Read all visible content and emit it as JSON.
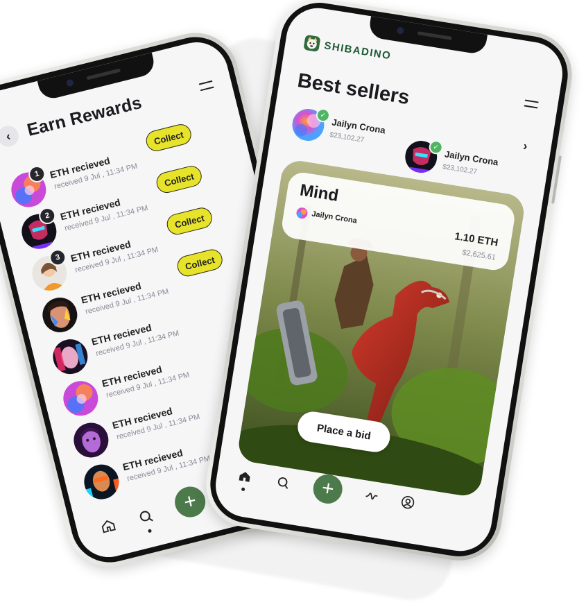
{
  "left_phone": {
    "title": "Earn Rewards",
    "rewards": [
      {
        "rank": "1",
        "title": "ETH recieved",
        "subtitle": "received 9 Jul , 11:34 PM",
        "action": "Collect",
        "avatar": "swirl"
      },
      {
        "rank": "2",
        "title": "ETH recieved",
        "subtitle": "received 9 Jul , 11:34 PM",
        "action": "Collect",
        "avatar": "neon-mask"
      },
      {
        "rank": "3",
        "title": "ETH recieved",
        "subtitle": "received 9 Jul , 11:34 PM",
        "action": "Collect",
        "avatar": "girl-orange"
      },
      {
        "rank": "",
        "title": "ETH recieved",
        "subtitle": "received 9 Jul , 11:34 PM",
        "action": "Collect",
        "avatar": "face-paint"
      },
      {
        "rank": "",
        "title": "ETH recieved",
        "subtitle": "received 9 Jul , 11:34 PM",
        "action": "",
        "avatar": "neon-face"
      },
      {
        "rank": "",
        "title": "ETH recieved",
        "subtitle": "received 9 Jul , 11:34 PM",
        "action": "",
        "avatar": "swirl"
      },
      {
        "rank": "",
        "title": "ETH recieved",
        "subtitle": "received 9 Jul , 11:34 PM",
        "action": "",
        "avatar": "purple-face"
      },
      {
        "rank": "",
        "title": "ETH recieved",
        "subtitle": "received 9 Jul , 11:34 PM",
        "action": "",
        "avatar": "cyber-man"
      }
    ],
    "nav": [
      "home-icon",
      "search-icon",
      "add-icon"
    ]
  },
  "right_phone": {
    "brand": "SHIBADINO",
    "section_title": "Best sellers",
    "sellers": [
      {
        "name": "Jailyn Crona",
        "value": "$23,102.27",
        "avatar": "swirl"
      },
      {
        "name": "Jailyn Crona",
        "value": "$23,102.27",
        "avatar": "neon-mask"
      }
    ],
    "nft": {
      "name": "Mind",
      "creator": "Jailyn Crona",
      "price_eth": "1.10 ETH",
      "price_usd": "$2,625.61",
      "bid_label": "Place a bid"
    },
    "nav": [
      "home-icon",
      "search-icon",
      "add-icon",
      "activity-icon",
      "profile-icon"
    ]
  },
  "colors": {
    "collect": "#e7e32a",
    "accent_green": "#4d7a4a",
    "brand_green": "#1e5a36",
    "verified": "#4fb464"
  }
}
